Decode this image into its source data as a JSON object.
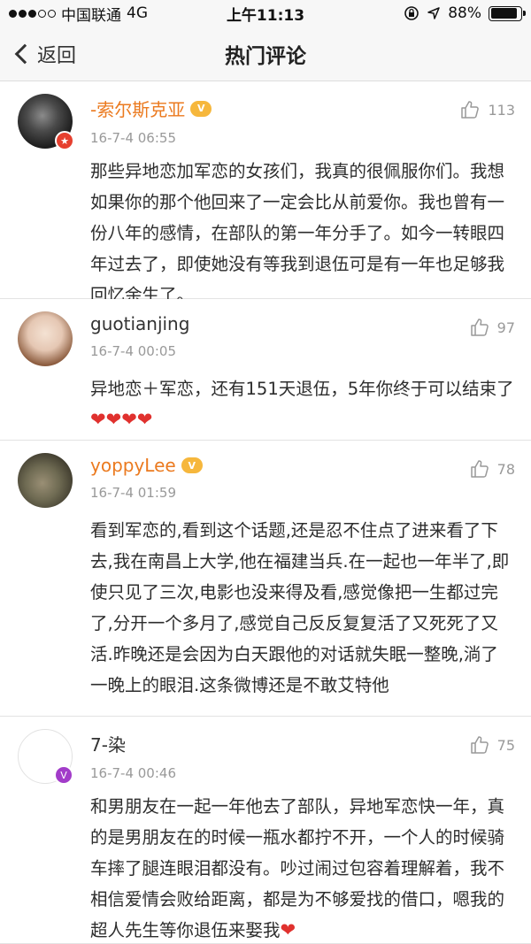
{
  "status_bar": {
    "carrier": "中国联通",
    "network": "4G",
    "time": "上午11:13",
    "battery_percent": "88%",
    "battery_level": 0.88,
    "signal_bars": [
      1,
      1,
      1,
      0,
      0
    ]
  },
  "nav": {
    "back_label": "返回",
    "title": "热门评论"
  },
  "comments": [
    {
      "username": "-索尔斯克亚",
      "time": "16-7-4 06:55",
      "likes": "113",
      "text": "那些异地恋加军恋的女孩们，我真的很佩服你们。我想如果你的那个他回来了一定会比从前爱你。我也曾有一份八年的感情，在部队的第一年分手了。如今一转眼四年过去了，即使她没有等我到退伍可是有一年也足够我回忆余生了。"
    },
    {
      "username": "guotianjing",
      "time": "16-7-4 00:05",
      "likes": "97",
      "text": "异地恋＋军恋，还有151天退伍，5年你终于可以结束了",
      "hearts": "❤❤❤❤"
    },
    {
      "username": "yoppyLee",
      "time": "16-7-4 01:59",
      "likes": "78",
      "text": "看到军恋的,看到这个话题,还是忍不住点了进来看了下去,我在南昌上大学,他在福建当兵.在一起也一年半了,即使只见了三次,电影也没来得及看,感觉像把一生都过完了,分开一个多月了,感觉自己反反复复活了又死死了又活.昨晚还是会因为白天跟他的对话就失眠一整晚,淌了一晚上的眼泪.这条微博还是不敢艾特他"
    },
    {
      "username": "7-染",
      "time": "16-7-4 00:46",
      "likes": "75",
      "text": "和男朋友在一起一年他去了部队，异地军恋快一年，真的是男朋友在的时候一瓶水都拧不开，一个人的时候骑车摔了腿连眼泪都没有。吵过闹过包容着理解着，我不相信爱情会败给距离，都是为不够爱找的借口，嗯我的超人先生等你退伍来娶我",
      "hearts": "❤"
    }
  ]
}
